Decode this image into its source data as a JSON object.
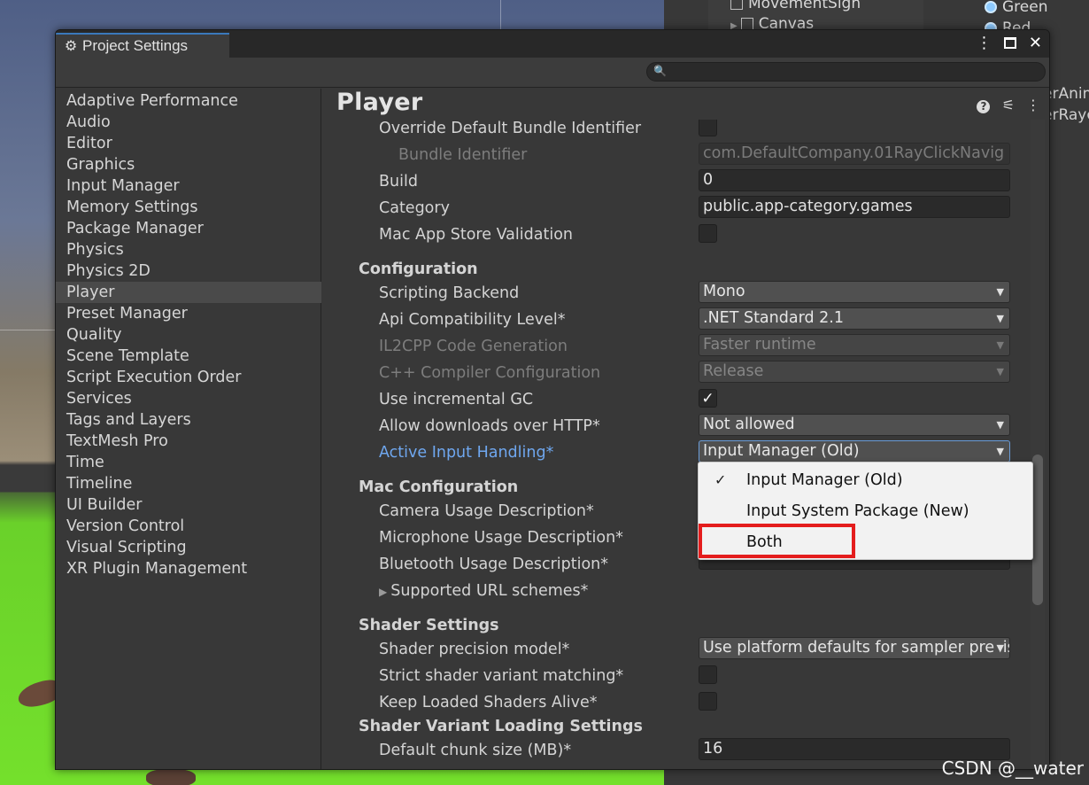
{
  "background": {
    "hierarchy": {
      "items": [
        {
          "label": "MovementSign",
          "icon": "cube-icon"
        },
        {
          "label": "Canvas",
          "icon": "cube-icon"
        }
      ],
      "right_items": [
        "Green",
        "Red"
      ],
      "fragments": [
        "erAnim",
        "erRayc"
      ]
    }
  },
  "window": {
    "tab_title": "Project Settings",
    "tab_icon": "gear-icon",
    "controls": {
      "more": "⋮",
      "close": "✕"
    },
    "search": {
      "placeholder": "",
      "value": ""
    }
  },
  "sidebar": {
    "selected": "Player",
    "items": [
      "Adaptive Performance",
      "Audio",
      "Editor",
      "Graphics",
      "Input Manager",
      "Memory Settings",
      "Package Manager",
      "Physics",
      "Physics 2D",
      "Player",
      "Preset Manager",
      "Quality",
      "Scene Template",
      "Script Execution Order",
      "Services",
      "Tags and Layers",
      "TextMesh Pro",
      "Time",
      "Timeline",
      "UI Builder",
      "Version Control",
      "Visual Scripting",
      "XR Plugin Management"
    ]
  },
  "main": {
    "title": "Player",
    "identification": {
      "override_bundle_label": "Override Default Bundle Identifier",
      "override_bundle_checked": false,
      "bundle_id_label": "Bundle Identifier",
      "bundle_id_value": "com.DefaultCompany.01RayClickNavig",
      "build_label": "Build",
      "build_value": "0",
      "category_label": "Category",
      "category_value": "public.app-category.games",
      "mac_store_label": "Mac App Store Validation",
      "mac_store_checked": false
    },
    "configuration": {
      "header": "Configuration",
      "scripting_backend_label": "Scripting Backend",
      "scripting_backend_value": "Mono",
      "api_label": "Api Compatibility Level*",
      "api_value": ".NET Standard 2.1",
      "il2cpp_label": "IL2CPP Code Generation",
      "il2cpp_value": "Faster runtime",
      "cpp_label": "C++ Compiler Configuration",
      "cpp_value": "Release",
      "incremental_gc_label": "Use incremental GC",
      "incremental_gc_checked": true,
      "http_label": "Allow downloads over HTTP*",
      "http_value": "Not allowed",
      "input_label": "Active Input Handling*",
      "input_value": "Input Manager (Old)"
    },
    "mac_configuration": {
      "header": "Mac Configuration",
      "camera_label": "Camera Usage Description*",
      "microphone_label": "Microphone Usage Description*",
      "bluetooth_label": "Bluetooth Usage Description*",
      "url_schemes_label": "Supported URL schemes*"
    },
    "shader_settings": {
      "header": "Shader Settings",
      "precision_label": "Shader precision model*",
      "precision_value": "Use platform defaults for sampler precision",
      "strict_label": "Strict shader variant matching*",
      "strict_checked": false,
      "keep_loaded_label": "Keep Loaded Shaders Alive*",
      "keep_loaded_checked": false
    },
    "shader_variant_loading": {
      "header": "Shader Variant Loading Settings",
      "chunk_size_label": "Default chunk size (MB)*",
      "chunk_size_value": "16"
    }
  },
  "popup": {
    "options": [
      {
        "label": "Input Manager (Old)",
        "checked": true
      },
      {
        "label": "Input System Package (New)",
        "checked": false
      },
      {
        "label": "Both",
        "checked": false,
        "highlighted": true
      }
    ],
    "highlight_color": "#e41d1d"
  },
  "watermark": "CSDN @__water"
}
